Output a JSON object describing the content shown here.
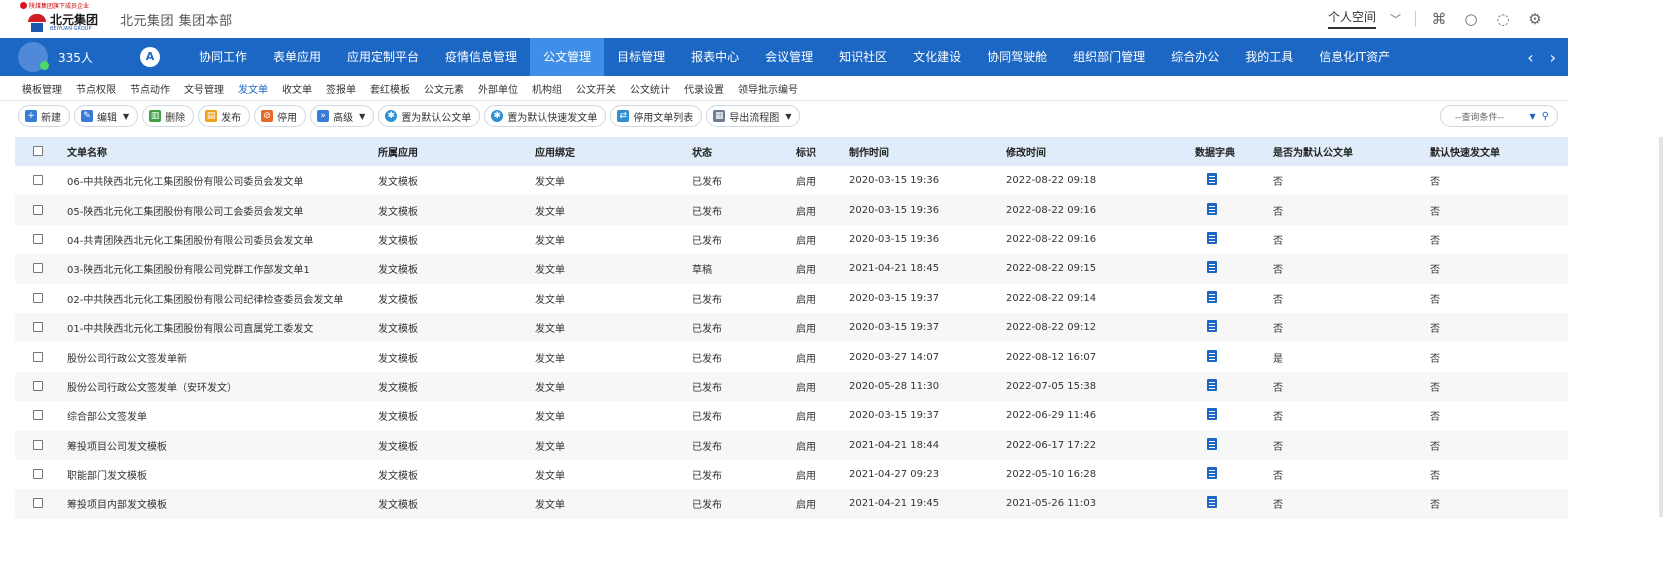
{
  "header": {
    "group_tag": "陕煤集团旗下成员企业",
    "brand_name": "北元集团",
    "brand_sub": "BEIYUAN GROUP",
    "org_title": "北元集团   集团本部",
    "personal_space": "个人空间"
  },
  "nav": {
    "headcount": "335人",
    "a_badge": "A",
    "items": [
      "协同工作",
      "表单应用",
      "应用定制平台",
      "疫情信息管理",
      "公文管理",
      "目标管理",
      "报表中心",
      "会议管理",
      "知识社区",
      "文化建设",
      "协同驾驶舱",
      "组织部门管理",
      "综合办公",
      "我的工具",
      "信息化IT资产"
    ],
    "active": "公文管理"
  },
  "subtabs": {
    "items": [
      "模板管理",
      "节点权限",
      "节点动作",
      "文号管理",
      "发文单",
      "收文单",
      "签报单",
      "套红模板",
      "公文元素",
      "外部单位",
      "机构组",
      "公文开关",
      "公文统计",
      "代录设置",
      "领导批示编号"
    ],
    "active": "发文单"
  },
  "toolbar": {
    "new": "新建",
    "edit": "编辑",
    "delete": "删除",
    "publish": "发布",
    "disable": "停用",
    "advanced": "高级",
    "set_default": "置为默认公文单",
    "set_default_quick": "置为默认快速发文单",
    "disabled_list": "停用文单列表",
    "export_flow": "导出流程图",
    "search_placeholder": "--查询条件--"
  },
  "table": {
    "columns": [
      "文单名称",
      "所属应用",
      "应用绑定",
      "状态",
      "标识",
      "制作时间",
      "修改时间",
      "数据字典",
      "是否为默认公文单",
      "默认快速发文单"
    ],
    "rows": [
      [
        "06-中共陕西北元化工集团股份有限公司委员会发文单",
        "发文模板",
        "发文单",
        "已发布",
        "启用",
        "2020-03-15 19:36",
        "2022-08-22 09:18",
        "否",
        "否"
      ],
      [
        "05-陕西北元化工集团股份有限公司工会委员会发文单",
        "发文模板",
        "发文单",
        "已发布",
        "启用",
        "2020-03-15 19:36",
        "2022-08-22 09:16",
        "否",
        "否"
      ],
      [
        "04-共青团陕西北元化工集团股份有限公司委员会发文单",
        "发文模板",
        "发文单",
        "已发布",
        "启用",
        "2020-03-15 19:36",
        "2022-08-22 09:16",
        "否",
        "否"
      ],
      [
        "03-陕西北元化工集团股份有限公司党群工作部发文单1",
        "发文模板",
        "发文单",
        "草稿",
        "启用",
        "2021-04-21 18:45",
        "2022-08-22 09:15",
        "否",
        "否"
      ],
      [
        "02-中共陕西北元化工集团股份有限公司纪律检查委员会发文单",
        "发文模板",
        "发文单",
        "已发布",
        "启用",
        "2020-03-15 19:37",
        "2022-08-22 09:14",
        "否",
        "否"
      ],
      [
        "01-中共陕西北元化工集团股份有限公司直属党工委发文",
        "发文模板",
        "发文单",
        "已发布",
        "启用",
        "2020-03-15 19:37",
        "2022-08-22 09:12",
        "否",
        "否"
      ],
      [
        "股份公司行政公文签发单新",
        "发文模板",
        "发文单",
        "已发布",
        "启用",
        "2020-03-27 14:07",
        "2022-08-12 16:07",
        "是",
        "否"
      ],
      [
        "股份公司行政公文签发单（安环发文）",
        "发文模板",
        "发文单",
        "已发布",
        "启用",
        "2020-05-28 11:30",
        "2022-07-05 15:38",
        "否",
        "否"
      ],
      [
        "综合部公文签发单",
        "发文模板",
        "发文单",
        "已发布",
        "启用",
        "2020-03-15 19:37",
        "2022-06-29 11:46",
        "否",
        "否"
      ],
      [
        "筹投项目公司发文模板",
        "发文模板",
        "发文单",
        "已发布",
        "启用",
        "2021-04-21 18:44",
        "2022-06-17 17:22",
        "否",
        "否"
      ],
      [
        "职能部门发文模板",
        "发文模板",
        "发文单",
        "已发布",
        "启用",
        "2021-04-27 09:23",
        "2022-05-10 16:28",
        "否",
        "否"
      ],
      [
        "筹投项目内部发文模板",
        "发文模板",
        "发文单",
        "已发布",
        "启用",
        "2021-04-21 19:45",
        "2021-05-26 11:03",
        "否",
        "否"
      ]
    ]
  },
  "colors": {
    "nav_blue": "#1d67c4",
    "nav_active": "#3f8fe8",
    "header_row": "#e0ecf9"
  }
}
